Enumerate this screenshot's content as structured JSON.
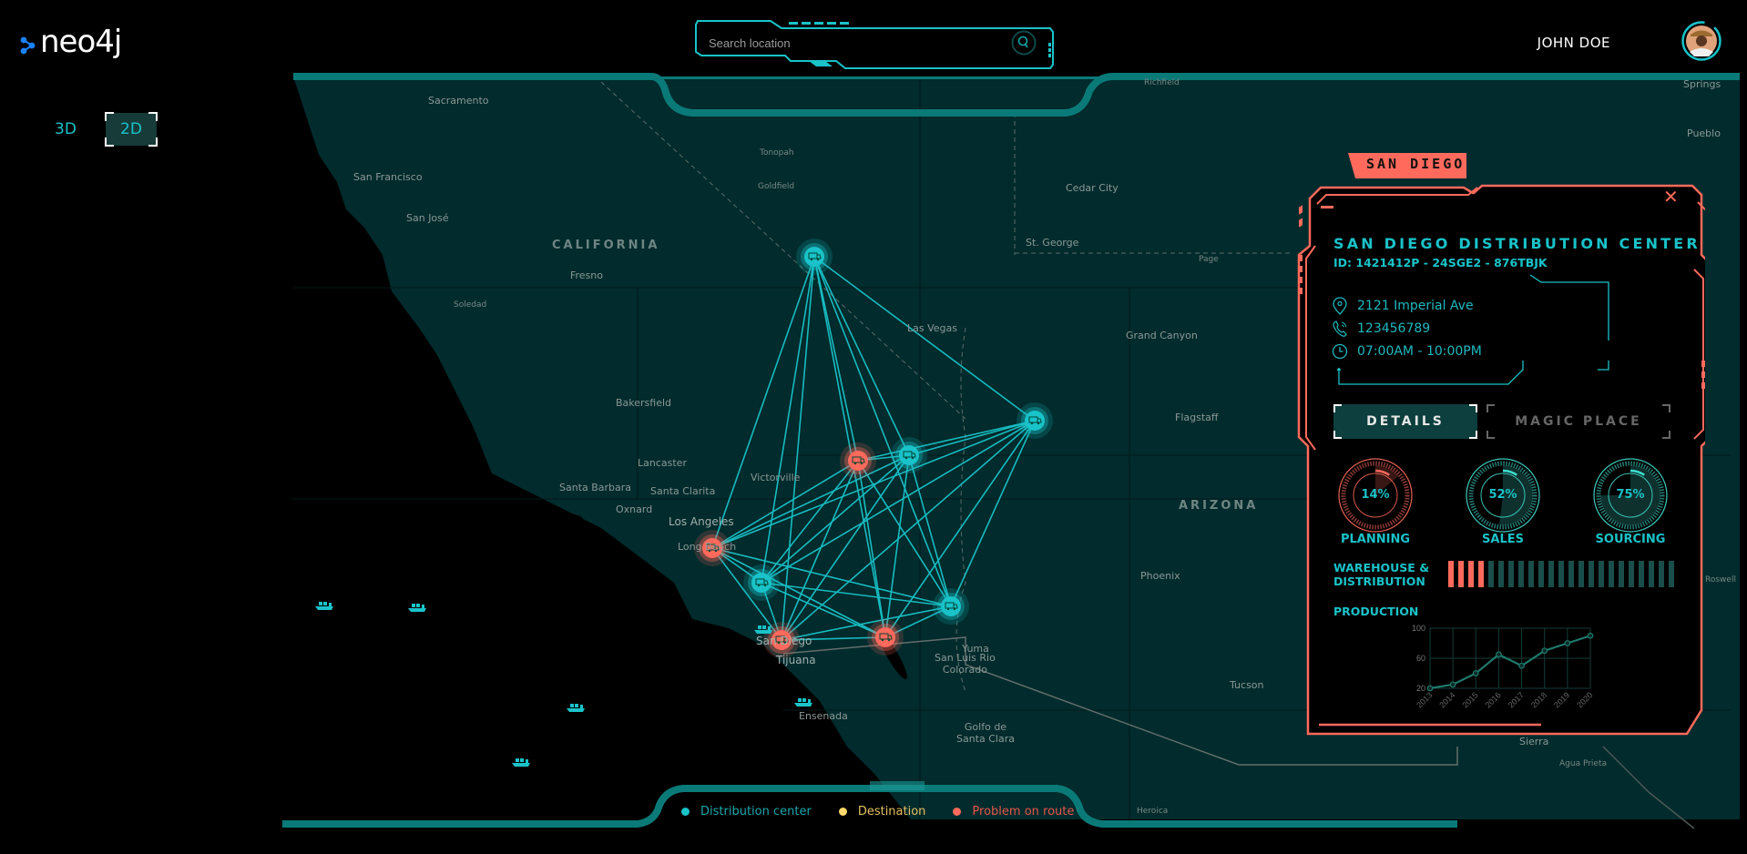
{
  "app": {
    "logo_text": "neo4j",
    "view_toggle": [
      {
        "label": "3D",
        "active": false
      },
      {
        "label": "2D",
        "active": true
      }
    ]
  },
  "search": {
    "placeholder": "Search location",
    "value": "",
    "icon": "search-icon"
  },
  "user": {
    "name": "JOHN DOE",
    "avatar_icon": "avatar-photo"
  },
  "colors": {
    "accent_cyan": "#19c3c9",
    "alert_red": "#ff6a5c",
    "destination_yellow": "#ffd86b",
    "map_land": "#012b2c",
    "map_water": "#000000",
    "frame_teal": "#0a7a78"
  },
  "map": {
    "labels": [
      {
        "text": "Sacramento",
        "kind": "city"
      },
      {
        "text": "San Francisco",
        "kind": "city"
      },
      {
        "text": "San José",
        "kind": "city"
      },
      {
        "text": "CALIFORNIA",
        "kind": "state"
      },
      {
        "text": "Fresno",
        "kind": "city"
      },
      {
        "text": "Soledad",
        "kind": "small"
      },
      {
        "text": "Tonopah",
        "kind": "small"
      },
      {
        "text": "Goldfield",
        "kind": "small"
      },
      {
        "text": "Richfield",
        "kind": "small"
      },
      {
        "text": "Cedar City",
        "kind": "city"
      },
      {
        "text": "St. George",
        "kind": "city"
      },
      {
        "text": "Page",
        "kind": "small"
      },
      {
        "text": "Las Vegas",
        "kind": "city"
      },
      {
        "text": "Grand Canyon",
        "kind": "city"
      },
      {
        "text": "Flagstaff",
        "kind": "city"
      },
      {
        "text": "Bakersfield",
        "kind": "city"
      },
      {
        "text": "Lancaster",
        "kind": "city"
      },
      {
        "text": "Victorville",
        "kind": "city"
      },
      {
        "text": "Santa Barbara",
        "kind": "city"
      },
      {
        "text": "Santa Clarita",
        "kind": "city"
      },
      {
        "text": "Oxnard",
        "kind": "city"
      },
      {
        "text": "Los Angeles",
        "kind": "big"
      },
      {
        "text": "Long Beach",
        "kind": "city"
      },
      {
        "text": "San Diego",
        "kind": "big"
      },
      {
        "text": "Tijuana",
        "kind": "big"
      },
      {
        "text": "Ensenada",
        "kind": "city"
      },
      {
        "text": "Yuma",
        "kind": "city"
      },
      {
        "text": "San Luis Rio Colorado",
        "kind": "city"
      },
      {
        "text": "Golfo de Santa Clara",
        "kind": "city"
      },
      {
        "text": "ARIZONA",
        "kind": "state"
      },
      {
        "text": "Phoenix",
        "kind": "city"
      },
      {
        "text": "Tucson",
        "kind": "city"
      },
      {
        "text": "Sierra",
        "kind": "city"
      },
      {
        "text": "Agua Prieta",
        "kind": "small"
      },
      {
        "text": "Heroica",
        "kind": "small"
      },
      {
        "text": "Springs",
        "kind": "city"
      },
      {
        "text": "Pueblo",
        "kind": "city"
      },
      {
        "text": "Roswell",
        "kind": "small"
      }
    ],
    "nodes": [
      {
        "id": "n1",
        "type": "distribution",
        "status": "ok"
      },
      {
        "id": "n2",
        "type": "distribution",
        "status": "ok"
      },
      {
        "id": "n3",
        "type": "distribution",
        "status": "problem"
      },
      {
        "id": "n4",
        "type": "distribution",
        "status": "ok"
      },
      {
        "id": "n5",
        "type": "distribution",
        "status": "problem"
      },
      {
        "id": "n6",
        "type": "distribution",
        "status": "ok"
      },
      {
        "id": "n7",
        "type": "distribution",
        "status": "problem"
      },
      {
        "id": "n8",
        "type": "distribution",
        "status": "ok"
      },
      {
        "id": "n9",
        "type": "distribution",
        "status": "problem"
      }
    ],
    "ships_count": 6
  },
  "legend": [
    {
      "label": "Distribution center",
      "color": "#19c3c9"
    },
    {
      "label": "Destination",
      "color": "#ffd86b"
    },
    {
      "label": "Problem on route",
      "color": "#ff6a5c"
    }
  ],
  "panel": {
    "tag": "SAN DIEGO",
    "title": "SAN DIEGO DISTRIBUTION CENTER",
    "id_line": "ID: 1421412P - 24SGE2 - 876TBJK",
    "address": "2121 Imperial Ave",
    "phone": "123456789",
    "hours": "07:00AM - 10:00PM",
    "tabs": [
      {
        "label": "DETAILS",
        "active": true
      },
      {
        "label": "MAGIC PLACE",
        "active": false
      }
    ],
    "gauges": [
      {
        "label": "PLANNING",
        "value_text": "14%",
        "value": 14,
        "color": "#ff6a5c"
      },
      {
        "label": "SALES",
        "value_text": "52%",
        "value": 52,
        "color": "#3fe0d0"
      },
      {
        "label": "SOURCING",
        "value_text": "75%",
        "value": 75,
        "color": "#3fe0d0"
      }
    ],
    "warehouse": {
      "label_line1": "WAREHOUSE &",
      "label_line2": "DISTRIBUTION",
      "active_segments": 4,
      "total_segments": 23
    },
    "production_label": "PRODUCTION"
  },
  "chart_data": {
    "type": "line",
    "title": "PRODUCTION",
    "x": [
      "2013",
      "2014",
      "2015",
      "2016",
      "2017",
      "2018",
      "2019",
      "2020"
    ],
    "series": [
      {
        "name": "Production",
        "values": [
          20,
          25,
          40,
          65,
          50,
          70,
          80,
          90
        ]
      }
    ],
    "yticks": [
      "20",
      "60",
      "100"
    ],
    "ylim": [
      20,
      100
    ],
    "grid": true,
    "xlabel": "",
    "ylabel": ""
  }
}
